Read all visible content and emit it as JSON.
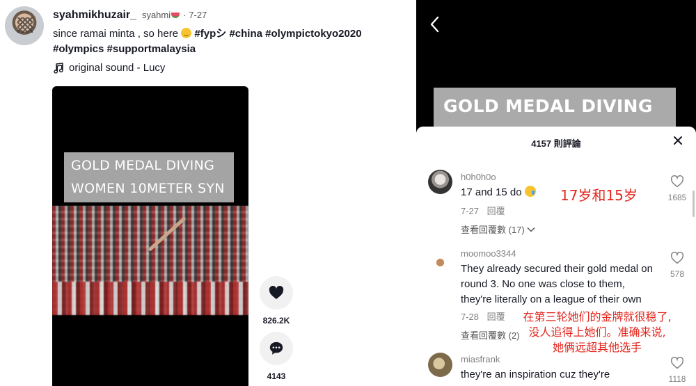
{
  "post": {
    "username": "syahmikhuzair_",
    "nickname": "syahmi",
    "separator": "·",
    "date": "7-27",
    "caption_text": "since ramai minta , so here",
    "hashtags_line1": [
      "#fypシ",
      "#china",
      "#olympictokyo2020"
    ],
    "hashtags_line2": [
      "#olympics",
      "#supportmalaysia"
    ],
    "sound": "original sound - Lucy",
    "video_overlay_line1": "GOLD MEDAL DIVING",
    "video_overlay_line2": "WOMEN 10METER SYN",
    "likes": "826.2K",
    "comments": "4143"
  },
  "panel": {
    "overlay_text": "GOLD MEDAL DIVING",
    "title": "4157 則評論",
    "comments": [
      {
        "user": "h0h0h0o",
        "text": "17 and 15 do",
        "date": "7-27",
        "reply_label": "回覆",
        "view_replies": "查看回覆數 (17)",
        "likes": "1685",
        "annotation": "17岁和15岁"
      },
      {
        "user": "moomoo3344",
        "text": "They already secured their gold medal on round 3. No one was close to them, they're literally on a league of their own",
        "date": "7-28",
        "reply_label": "回覆",
        "view_replies": "查看回覆數 (2)",
        "likes": "578",
        "annotation_lines": [
          "在第三轮她们的金牌就很稳了,",
          "没人追得上她们。准确来说,",
          "她俩远超其他选手"
        ]
      },
      {
        "user": "miasfrank",
        "text": "they're an inspiration cuz they're",
        "likes": "1118"
      }
    ]
  },
  "icons": {
    "back": "chevron-left-icon",
    "close": "close-icon",
    "like": "heart-icon",
    "comment": "comment-bubble-icon",
    "music": "music-note-icon"
  },
  "colors": {
    "annotation_red": "#e2261d",
    "panel_bg": "#000000",
    "sheet_bg": "#ffffff"
  }
}
